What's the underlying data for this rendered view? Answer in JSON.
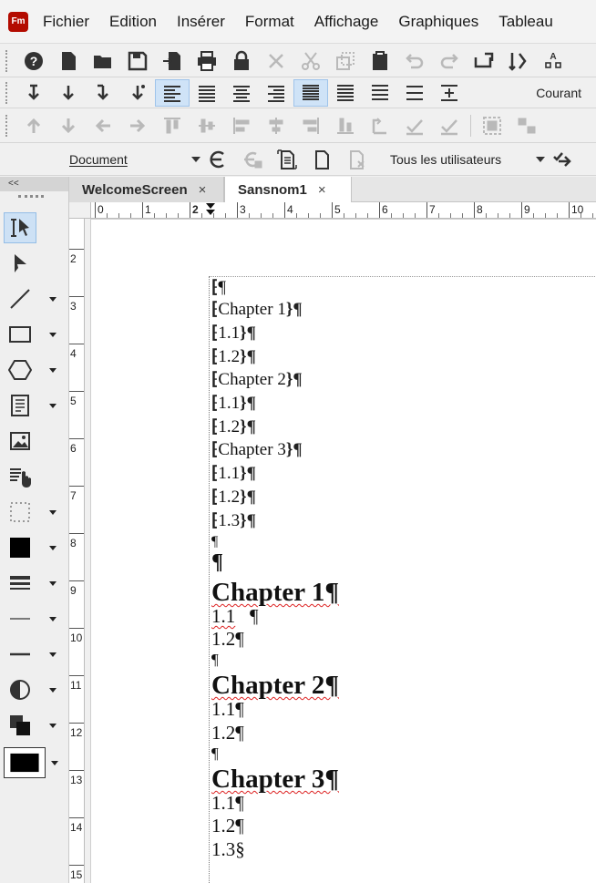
{
  "app": {
    "logo_text": "Fm",
    "menu": [
      "Fichier",
      "Edition",
      "Insérer",
      "Format",
      "Affichage",
      "Graphiques",
      "Tableau"
    ]
  },
  "toolbar": {
    "paragraph_style": "Courant",
    "view_select": "Document",
    "users_select": "Tous les utilisateurs"
  },
  "tabs": [
    {
      "label": "WelcomeScreen",
      "close": "×"
    },
    {
      "label": "Sansnom1",
      "close": "×"
    }
  ],
  "toolpanel": {
    "collapse_label": "<<"
  },
  "ruler": {
    "h_numbers": [
      "0",
      "1",
      "2",
      "3",
      "4",
      "5",
      "6",
      "7",
      "8",
      "9",
      "10"
    ],
    "v_numbers": [
      "2",
      "3",
      "4",
      "5",
      "6",
      "7",
      "8",
      "9",
      "10",
      "11",
      "12",
      "13",
      "14",
      "15"
    ],
    "indent_marker": "2"
  },
  "document": {
    "toc_first": "¶",
    "toc": [
      "Chapter 1",
      "1.1",
      "1.2",
      "Chapter 2",
      "1.1",
      "1.2",
      "Chapter 3",
      "1.1",
      "1.2",
      "1.3"
    ],
    "toc_end_mark": "}¶",
    "pilcrow": "¶",
    "chapters": [
      {
        "title": "Chapter 1¶",
        "items": [
          "1.1",
          "1.2¶"
        ]
      },
      {
        "title": "Chapter 2¶",
        "items": [
          "1.1¶",
          "1.2¶"
        ]
      },
      {
        "title": "Chapter 3¶",
        "items": [
          "1.1¶",
          "1.2¶",
          "1.3§"
        ]
      }
    ],
    "chapter1_item1_mark": "¶"
  }
}
